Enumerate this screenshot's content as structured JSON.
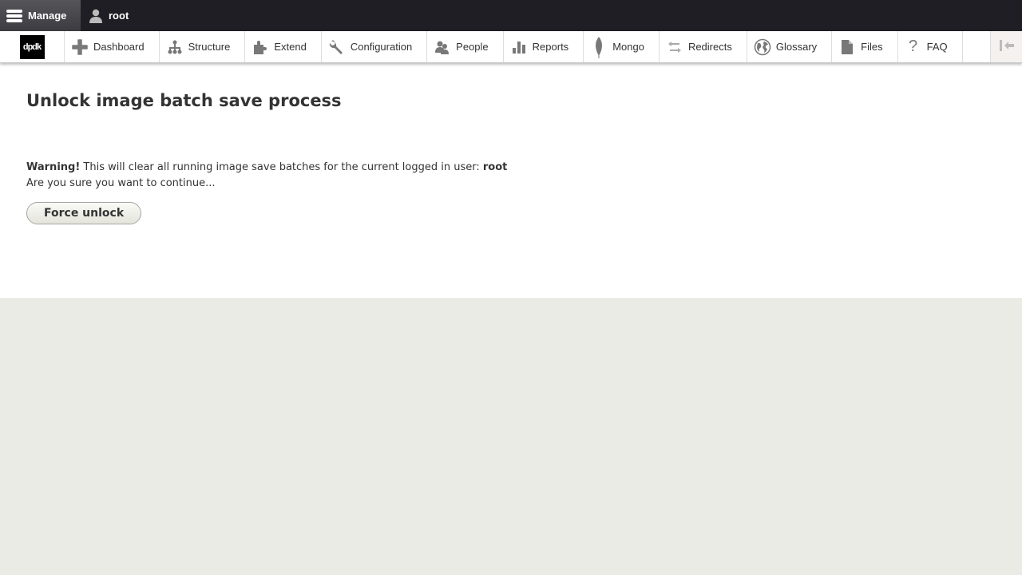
{
  "toolbar": {
    "manage_label": "Manage",
    "user_label": "root"
  },
  "tray": {
    "logo_text": "dpdk",
    "items": [
      {
        "label": "Dashboard",
        "icon": "plus-icon"
      },
      {
        "label": "Structure",
        "icon": "sitemap-icon"
      },
      {
        "label": "Extend",
        "icon": "puzzle-icon"
      },
      {
        "label": "Configuration",
        "icon": "wrench-icon"
      },
      {
        "label": "People",
        "icon": "people-icon"
      },
      {
        "label": "Reports",
        "icon": "bar-chart-icon"
      },
      {
        "label": "Mongo",
        "icon": "leaf-icon"
      },
      {
        "label": "Redirects",
        "icon": "redirect-arrows-icon"
      },
      {
        "label": "Glossary",
        "icon": "globe-icon"
      },
      {
        "label": "Files",
        "icon": "file-icon"
      },
      {
        "label": "FAQ",
        "icon": "question-icon"
      }
    ]
  },
  "page": {
    "title": "Unlock image batch save process",
    "warning_label": "Warning!",
    "warning_text": " This will clear all running image save batches for the current logged in user: ",
    "warning_user": "root",
    "confirm_text": "Are you sure you want to continue...",
    "button_label": "Force unlock"
  },
  "colors": {
    "toolbar_bg": "#1f1e24",
    "page_bg": "#ebebe5",
    "icon_gray": "#787878"
  }
}
